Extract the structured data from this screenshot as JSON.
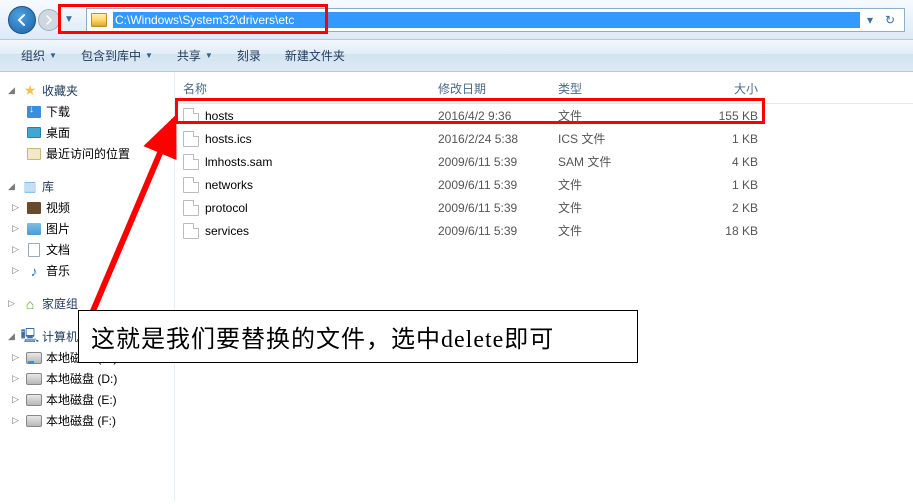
{
  "address": {
    "path": "C:\\Windows\\System32\\drivers\\etc"
  },
  "toolbar": {
    "organize": "组织",
    "include": "包含到库中",
    "share": "共享",
    "burn": "刻录",
    "new_folder": "新建文件夹"
  },
  "sidebar": {
    "favorites": {
      "label": "收藏夹",
      "items": [
        {
          "label": "下载"
        },
        {
          "label": "桌面"
        },
        {
          "label": "最近访问的位置"
        }
      ]
    },
    "libraries": {
      "label": "库",
      "items": [
        {
          "label": "视频"
        },
        {
          "label": "图片"
        },
        {
          "label": "文档"
        },
        {
          "label": "音乐"
        }
      ]
    },
    "homegroup": {
      "label": "家庭组"
    },
    "computer": {
      "label": "计算机",
      "items": [
        {
          "label": "本地磁盘 (C:)"
        },
        {
          "label": "本地磁盘 (D:)"
        },
        {
          "label": "本地磁盘 (E:)"
        },
        {
          "label": "本地磁盘 (F:)"
        }
      ]
    }
  },
  "columns": {
    "name": "名称",
    "date": "修改日期",
    "type": "类型",
    "size": "大小"
  },
  "files": [
    {
      "name": "hosts",
      "date": "2016/4/2 9:36",
      "type": "文件",
      "size": "155 KB"
    },
    {
      "name": "hosts.ics",
      "date": "2016/2/24 5:38",
      "type": "ICS 文件",
      "size": "1 KB"
    },
    {
      "name": "lmhosts.sam",
      "date": "2009/6/11 5:39",
      "type": "SAM 文件",
      "size": "4 KB"
    },
    {
      "name": "networks",
      "date": "2009/6/11 5:39",
      "type": "文件",
      "size": "1 KB"
    },
    {
      "name": "protocol",
      "date": "2009/6/11 5:39",
      "type": "文件",
      "size": "2 KB"
    },
    {
      "name": "services",
      "date": "2009/6/11 5:39",
      "type": "文件",
      "size": "18 KB"
    }
  ],
  "annotation": "这就是我们要替换的文件，选中delete即可"
}
